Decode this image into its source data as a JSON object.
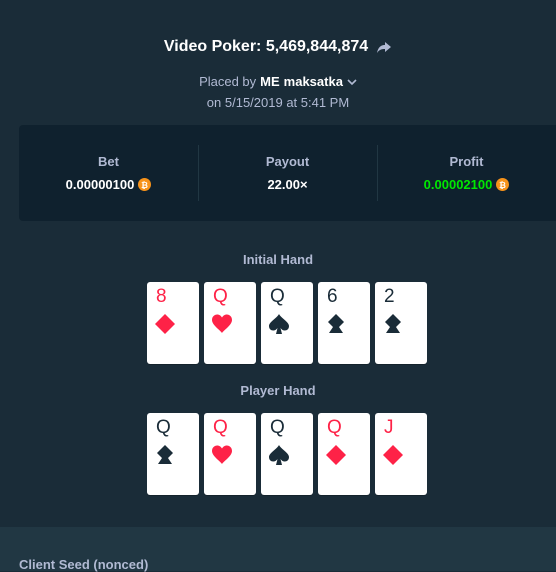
{
  "header": {
    "title": "Video Poker: 5,469,844,874",
    "placed_prefix": "Placed by",
    "user_badge": "ME",
    "username": "maksatka",
    "date_text": "on 5/15/2019 at 5:41 PM"
  },
  "stats": {
    "bet_label": "Bet",
    "bet_value": "0.00000100",
    "payout_label": "Payout",
    "payout_value": "22.00×",
    "profit_label": "Profit",
    "profit_value": "0.00002100"
  },
  "colors": {
    "background": "#1a2c38",
    "panel": "#0f212e",
    "profit_green": "#00e701",
    "card_red": "#fe2247",
    "btc_orange": "#f7931a"
  },
  "initial_hand": {
    "title": "Initial Hand",
    "cards": [
      {
        "rank": "8",
        "suit": "diamond",
        "color": "red"
      },
      {
        "rank": "Q",
        "suit": "heart",
        "color": "red"
      },
      {
        "rank": "Q",
        "suit": "spade",
        "color": "black"
      },
      {
        "rank": "6",
        "suit": "club",
        "color": "black"
      },
      {
        "rank": "2",
        "suit": "club",
        "color": "black"
      }
    ]
  },
  "player_hand": {
    "title": "Player Hand",
    "cards": [
      {
        "rank": "Q",
        "suit": "club",
        "color": "black"
      },
      {
        "rank": "Q",
        "suit": "heart",
        "color": "red"
      },
      {
        "rank": "Q",
        "suit": "spade",
        "color": "black"
      },
      {
        "rank": "Q",
        "suit": "diamond",
        "color": "red"
      },
      {
        "rank": "J",
        "suit": "diamond",
        "color": "red"
      }
    ]
  },
  "footer": {
    "client_seed_label": "Client Seed (nonced)"
  }
}
